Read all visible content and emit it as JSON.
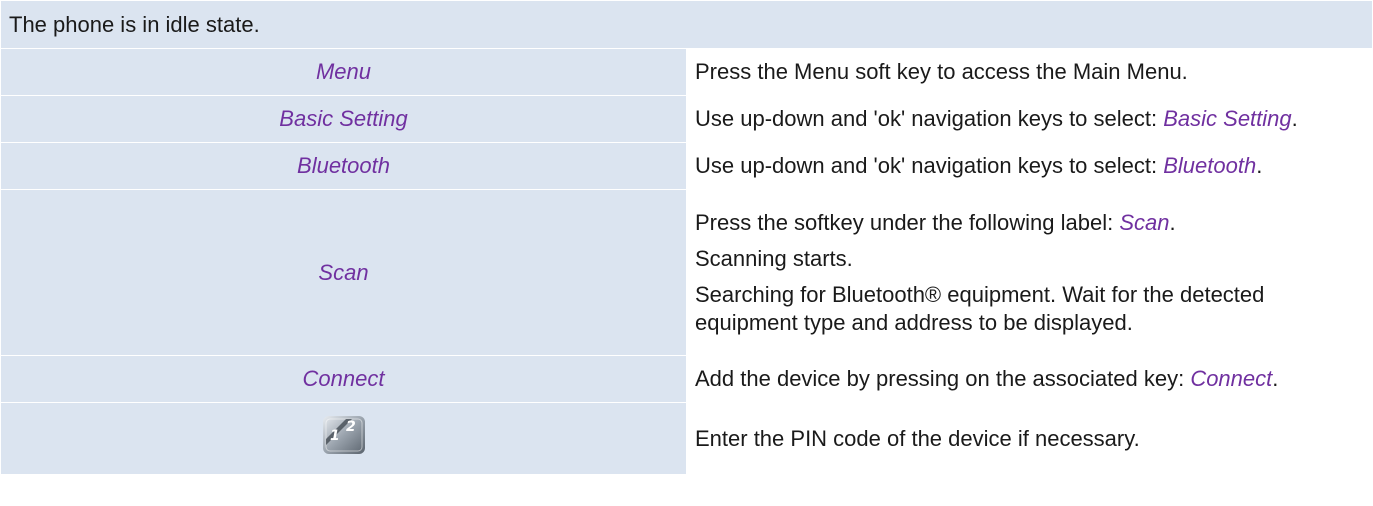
{
  "header": {
    "text": "The phone is in idle state."
  },
  "rows": [
    {
      "key": "Menu",
      "desc": "Press the Menu soft key to access the Main Menu."
    },
    {
      "key": "Basic Setting",
      "desc_prefix": "Use up-down and 'ok' navigation keys to select: ",
      "desc_accent": "Basic Setting",
      "desc_suffix": "."
    },
    {
      "key": "Bluetooth",
      "desc_prefix": "Use up-down and 'ok' navigation keys to select: ",
      "desc_accent": "Bluetooth",
      "desc_suffix": "."
    },
    {
      "key": "Scan",
      "line1_prefix": "Press the softkey under the following label: ",
      "line1_accent": "Scan",
      "line1_suffix": ".",
      "line2": "Scanning starts.",
      "line3": "Searching for Bluetooth® equipment. Wait for the detected equipment type and address to be displayed."
    },
    {
      "key": "Connect",
      "desc_prefix": "Add the device by pressing on the associated key: ",
      "desc_accent": "Connect",
      "desc_suffix": "."
    },
    {
      "key_icon": "keypad-icon",
      "desc": "Enter the PIN code of the device if necessary."
    }
  ],
  "colors": {
    "band": "#dbe4f0",
    "accent": "#7030a0",
    "text": "#1a1a1a"
  }
}
